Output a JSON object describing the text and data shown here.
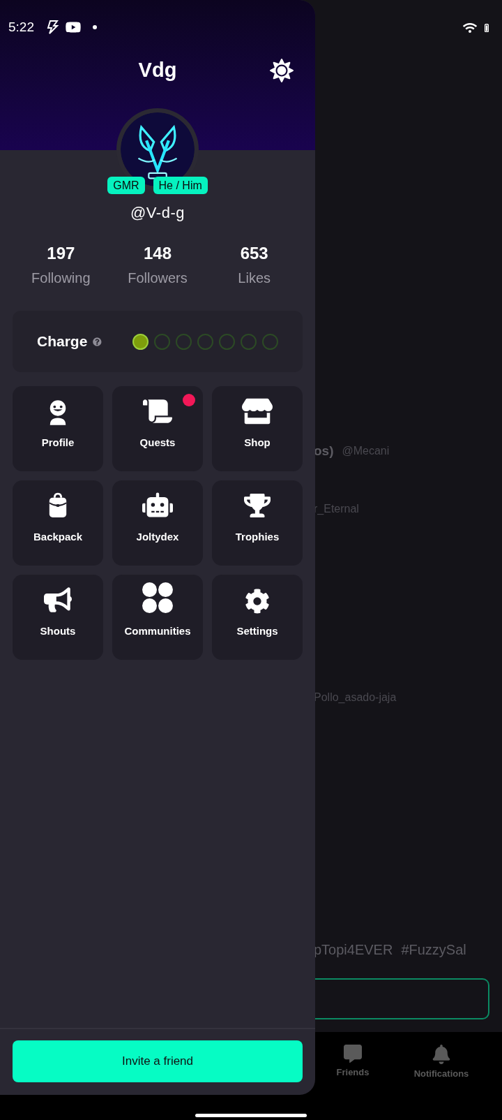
{
  "status_bar": {
    "time": "5:22"
  },
  "drawer": {
    "title": "Vdg",
    "badges": [
      "GMR",
      "He / Him"
    ],
    "handle": "@V-d-g",
    "stats": [
      {
        "value": "197",
        "label": "Following"
      },
      {
        "value": "148",
        "label": "Followers"
      },
      {
        "value": "653",
        "label": "Likes"
      }
    ],
    "charge": {
      "label": "Charge",
      "dots": [
        {
          "filled": true
        },
        {
          "filled": false
        },
        {
          "filled": false
        },
        {
          "filled": false
        },
        {
          "filled": false
        },
        {
          "filled": false
        },
        {
          "filled": false
        }
      ]
    },
    "menu": [
      {
        "label": "Profile",
        "notification": false
      },
      {
        "label": "Quests",
        "notification": true
      },
      {
        "label": "Shop",
        "notification": false
      },
      {
        "label": "Backpack",
        "notification": false
      },
      {
        "label": "Joltydex",
        "notification": false
      },
      {
        "label": "Trophies",
        "notification": false
      },
      {
        "label": "Shouts",
        "notification": false
      },
      {
        "label": "Communities",
        "notification": false
      },
      {
        "label": "Settings",
        "notification": false
      }
    ],
    "invite_button": "Invite a friend"
  },
  "background": {
    "feed": [
      {
        "name": "os)",
        "handle": "@Mecani"
      },
      {
        "handle": "r_Eternal"
      },
      {
        "handle": "Pollo_asado-jaja"
      }
    ],
    "tags": [
      "pTopi4EVER",
      "#FuzzySal"
    ],
    "nav": [
      {
        "label": "Friends"
      },
      {
        "label": "Notifications"
      }
    ]
  }
}
